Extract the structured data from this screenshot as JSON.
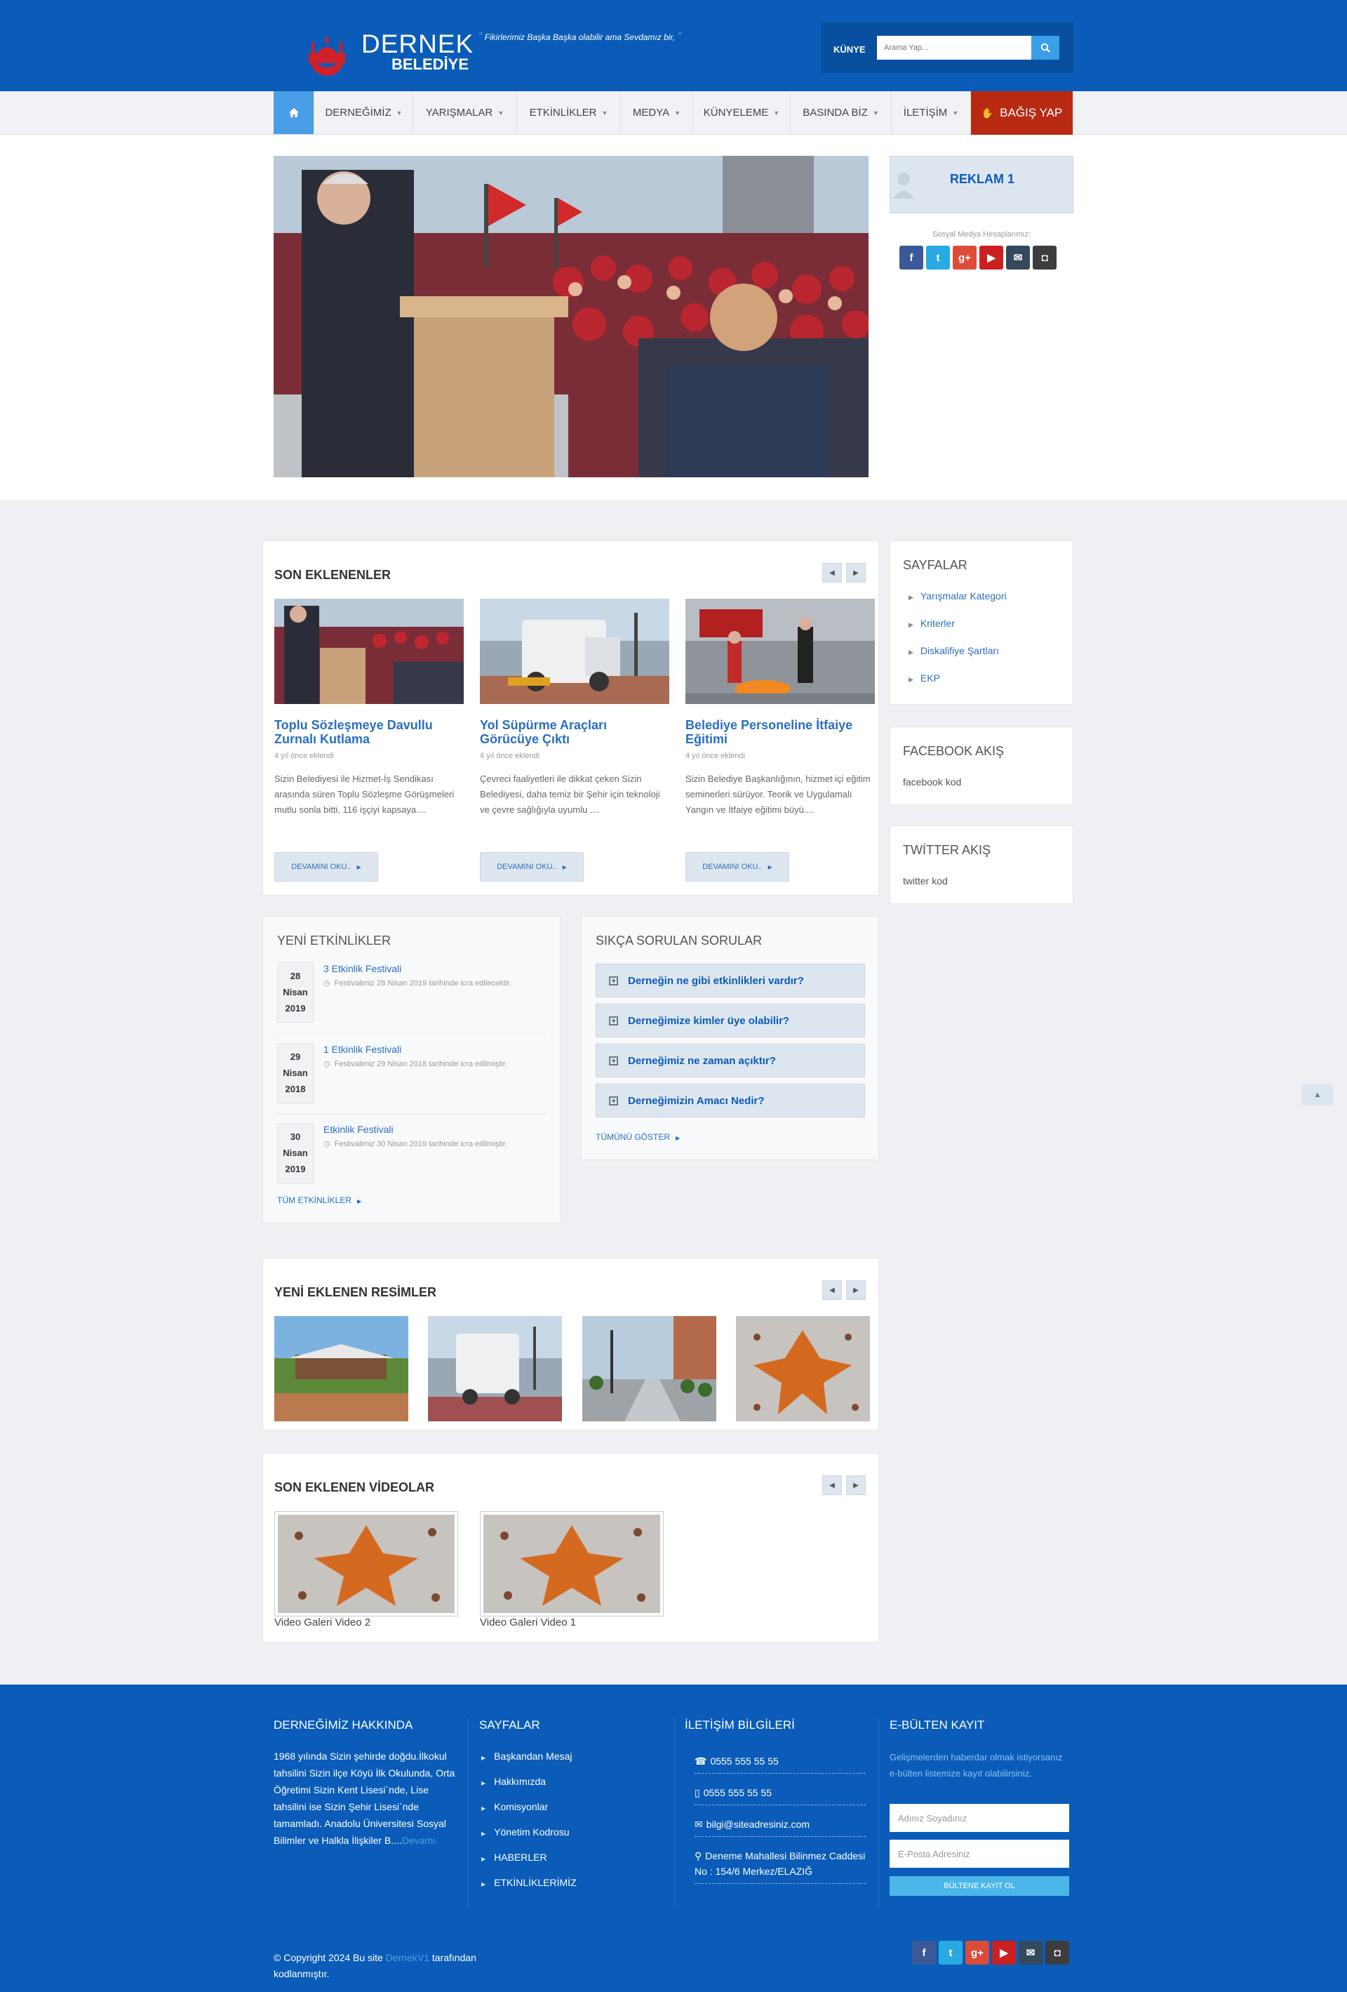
{
  "header": {
    "logo_title": "DERNEK",
    "logo_sub": "BELEDİYE",
    "slogan": "Fikirlerimiz Başka Başka olabilir ama Sevdamız bir,",
    "kunye_label": "KÜNYE",
    "search_placeholder": "Arama Yap..."
  },
  "nav": {
    "items": [
      "DERNEĞİMİZ",
      "YARIŞMALAR",
      "ETKİNLİKLER",
      "MEDYA",
      "KÜNYELEME",
      "BASINDA BİZ",
      "İLETİŞİM"
    ],
    "bagis": "BAĞIŞ YAP"
  },
  "sidebar": {
    "reklam": "REKLAM 1",
    "social_label": "Sosyal Medya Hesaplarımız:",
    "sayfalar_title": "SAYFALAR",
    "sayfalar": [
      "Yarışmalar Kategori",
      "Kriterler",
      "Diskalifiye Şartları",
      "EKP"
    ],
    "facebook_title": "FACEBOOK AKIŞ",
    "facebook_text": "facebook kod",
    "twitter_title": "TWİTTER AKIŞ",
    "twitter_text": "twitter kod"
  },
  "social": {
    "icons": [
      "facebook-icon",
      "twitter-icon",
      "google-plus-icon",
      "youtube-icon",
      "mail-icon",
      "instagram-icon"
    ],
    "glyphs": [
      "f",
      "t",
      "g+",
      "▶",
      "✉",
      "◘"
    ],
    "colors": [
      "#3b5998",
      "#29a9e1",
      "#dd4b39",
      "#cc1f1f",
      "#34495e",
      "#3d3d3d"
    ]
  },
  "son_eklenenler": {
    "title": "SON EKLENENLER",
    "items": [
      {
        "title": "Toplu Sözleşmeye Davullu Zurnalı Kutlama",
        "meta": "4 yıl önce eklendi",
        "text": "Sizin Belediyesi ile Hizmet-İş Sendikası arasında süren Toplu Sözleşme Görüşmeleri mutlu sonla bitti. 116 işçiyi kapsaya....",
        "more": "DEVAMINI OKU.."
      },
      {
        "title": "Yol Süpürme Araçları Görücüye Çıktı",
        "meta": "4 yıl önce eklendi",
        "text": "Çevreci faaliyetleri ile dikkat çeken Sizin Belediyesi, daha temiz bir Şehir için teknoloji ve çevre sağlığıyla uyumlu ....",
        "more": "DEVAMINI OKU.."
      },
      {
        "title": "Belediye Personeline İtfaiye Eğitimi",
        "meta": "4 yıl önce eklendi",
        "text": "Sizin Belediye Başkanlığının, hizmet içi eğitim seminerleri sürüyor. Teorik ve Uygulamalı Yangın ve İtfaiye eğitimi büyü....",
        "more": "DEVAMINI OKU.."
      }
    ]
  },
  "etkinlikler": {
    "title": "YENİ ETKİNLİKLER",
    "items": [
      {
        "day": "28",
        "month": "Nisan",
        "year": "2019",
        "title": "3 Etkinlik Festivali",
        "desc": "Festivalimiz 28 Nisan 2019 tarihinde icra edilecektir."
      },
      {
        "day": "29",
        "month": "Nisan",
        "year": "2018",
        "title": "1 Etkinlik Festivali",
        "desc": "Festivalimiz 29 Nisan 2018 tarihinde icra edilmiştir."
      },
      {
        "day": "30",
        "month": "Nisan",
        "year": "2019",
        "title": "Etkinlik Festivali",
        "desc": "Festivalimiz 30 Nisan 2019 tarihinde icra edilmiştir."
      }
    ],
    "all_link": "TÜM ETKİNLİKLER"
  },
  "sss": {
    "title": "SIKÇA SORULAN SORULAR",
    "items": [
      "Derneğin ne gibi etkinlikleri vardır?",
      "Derneğimize kimler üye olabilir?",
      "Derneğimiz ne zaman açıktır?",
      "Derneğimizin Amacı Nedir?"
    ],
    "all_link": "TÜMÜNÜ GÖSTER"
  },
  "resimler": {
    "title": "YENİ EKLENEN RESİMLER"
  },
  "videolar": {
    "title": "SON EKLENEN VİDEOLAR",
    "items": [
      "Video Galeri Video 2",
      "Video Galeri Video 1"
    ]
  },
  "footer": {
    "about_title": "DERNEĞİMİZ HAKKINDA",
    "about_text": "1968 yılında Sizin şehirde doğdu.İlkokul tahsilini Sizin ilçe Köyü İlk Okulunda, Orta Öğretimi Sizin Kent Lisesi`nde, Lise tahsilini ise Sizin Şehir Lisesi`nde tamamladı. Anadolu Üniversitesi Sosyal Bilimler ve Halkla İlişkiler B....",
    "about_more": "Devamı.",
    "pages_title": "SAYFALAR",
    "pages": [
      "Başkandan Mesaj",
      "Hakkımızda",
      "Komisyonlar",
      "Yönetim Kodrosu",
      "HABERLER",
      "ETKİNLİKLERİMİZ"
    ],
    "contact_title": "İLETİŞİM BİLGİLERİ",
    "phone1": "0555 555 55 55",
    "phone2": "0555 555 55 55",
    "email": "bilgi@siteadresiniz.com",
    "address": "Deneme Mahallesi Bilinmez Caddesi No : 154/6 Merkez/ELAZIĞ",
    "newsletter_title": "E-BÜLTEN KAYIT",
    "newsletter_text": "Gelişmelerden haberdar olmak istiyorsanız e-bülten listemize kayıt olabilirsiniz.",
    "name_placeholder": "Adınız Soyadınız",
    "email_placeholder": "E-Posta Adresiniz",
    "subscribe": "BÜLTENE KAYIT OL",
    "copyright_pre": "© Copyright 2024 Bu site",
    "copyright_brand": "DernekV1",
    "copyright_post": "tarafından kodlanmıştır."
  }
}
